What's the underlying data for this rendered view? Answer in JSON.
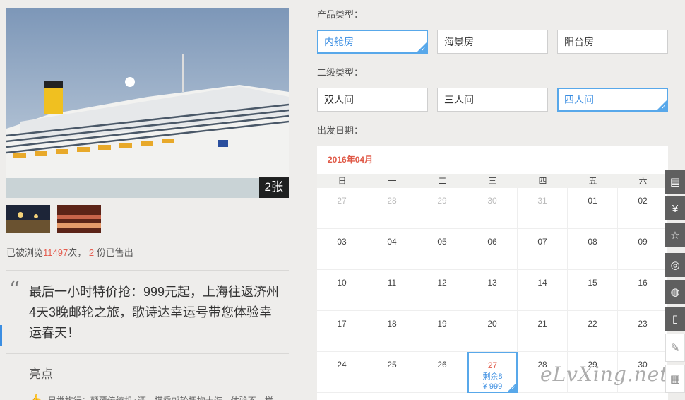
{
  "gallery": {
    "photo_count": "2张"
  },
  "stats": {
    "viewed_prefix": "已被浏览",
    "views": "11497",
    "viewed_suffix": "次，",
    "sold": "2",
    "sold_suffix": "份已售出"
  },
  "quote": {
    "text": "最后一小时特价抢：999元起，上海往返济州4天3晚邮轮之旅，歌诗达幸运号带您体验幸运春天！"
  },
  "highlights": {
    "title": "亮点",
    "item": "另类旅行：颠覆传统机+酒，搭乘邮轮拥抱大海，体验不一样"
  },
  "product_type": {
    "label": "产品类型：",
    "options": [
      {
        "label": "内舱房",
        "selected": true
      },
      {
        "label": "海景房",
        "selected": false
      },
      {
        "label": "阳台房",
        "selected": false
      }
    ]
  },
  "sub_type": {
    "label": "二级类型：",
    "options": [
      {
        "label": "双人间",
        "selected": false
      },
      {
        "label": "三人间",
        "selected": false
      },
      {
        "label": "四人间",
        "selected": true
      }
    ]
  },
  "departure": {
    "label": "出发日期："
  },
  "calendar": {
    "month": "2016年04月",
    "weekdays": [
      "日",
      "一",
      "二",
      "三",
      "四",
      "五",
      "六"
    ],
    "selected_remaining": "剩余8",
    "selected_price": "¥ 999",
    "weeks": [
      [
        "27",
        "28",
        "29",
        "30",
        "31",
        "01",
        "02"
      ],
      [
        "03",
        "04",
        "05",
        "06",
        "07",
        "08",
        "09"
      ],
      [
        "10",
        "11",
        "12",
        "13",
        "14",
        "15",
        "16"
      ],
      [
        "17",
        "18",
        "19",
        "20",
        "21",
        "22",
        "23"
      ],
      [
        "24",
        "25",
        "26",
        "27",
        "28",
        "29",
        "30"
      ]
    ]
  },
  "watermark": "eLvXing.net",
  "sidebar": [
    "clipboard-icon",
    "yen-icon",
    "star-icon",
    "weibo-icon",
    "wechat-icon",
    "phone-icon",
    "pencil-icon",
    "qrcode-icon"
  ]
}
